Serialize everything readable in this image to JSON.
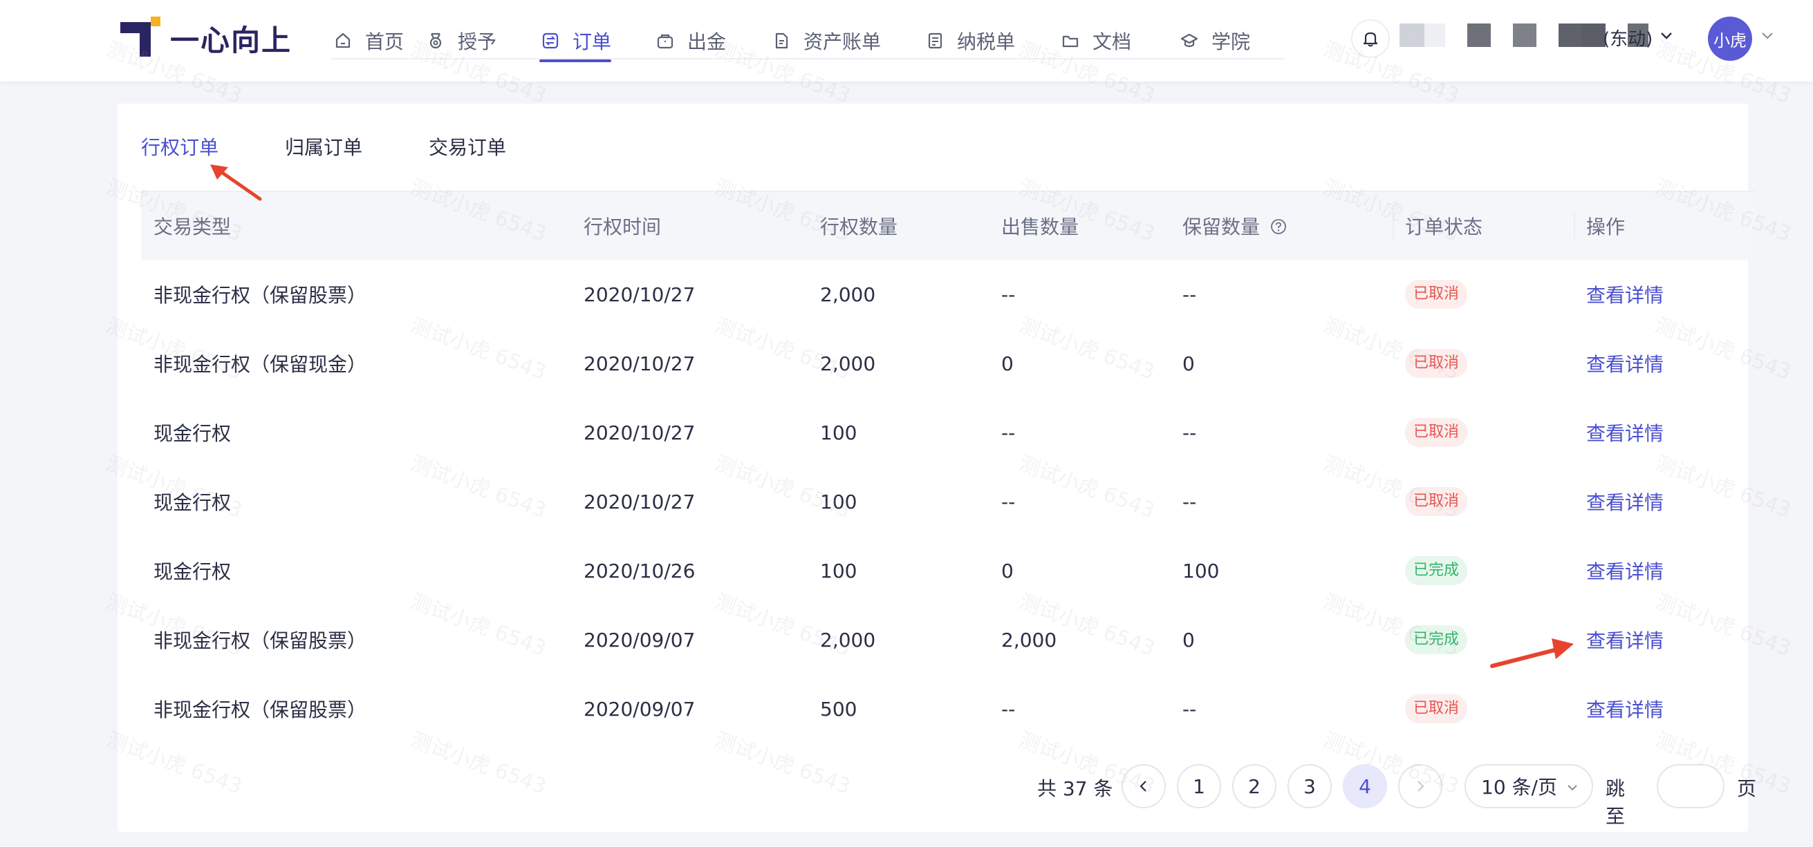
{
  "header": {
    "logo_text": "一心向上",
    "nav": [
      {
        "label": "首页",
        "icon": "home-icon"
      },
      {
        "label": "授予",
        "icon": "medal-icon"
      },
      {
        "label": "订单",
        "icon": "order-exchange-icon",
        "active": true
      },
      {
        "label": "出金",
        "icon": "wallet-icon"
      },
      {
        "label": "资产账单",
        "icon": "document-icon"
      },
      {
        "label": "纳税单",
        "icon": "list-doc-icon"
      },
      {
        "label": "文档",
        "icon": "folder-icon"
      },
      {
        "label": "学院",
        "icon": "graduation-cap-icon"
      }
    ],
    "company_suffix": "(东动)",
    "avatar_text": "小虎"
  },
  "tabs": [
    {
      "label": "行权订单",
      "active": true
    },
    {
      "label": "归属订单"
    },
    {
      "label": "交易订单"
    }
  ],
  "table": {
    "headers": [
      "交易类型",
      "行权时间",
      "行权数量",
      "出售数量",
      "保留数量",
      "订单状态",
      "操作"
    ],
    "rows": [
      {
        "type": "非现金行权（保留股票）",
        "date": "2020/10/27",
        "exercise": "2,000",
        "sold": "--",
        "kept": "--",
        "status": "已取消",
        "action": "查看详情"
      },
      {
        "type": "非现金行权（保留现金）",
        "date": "2020/10/27",
        "exercise": "2,000",
        "sold": "0",
        "kept": "0",
        "status": "已取消",
        "action": "查看详情"
      },
      {
        "type": "现金行权",
        "date": "2020/10/27",
        "exercise": "100",
        "sold": "--",
        "kept": "--",
        "status": "已取消",
        "action": "查看详情"
      },
      {
        "type": "现金行权",
        "date": "2020/10/27",
        "exercise": "100",
        "sold": "--",
        "kept": "--",
        "status": "已取消",
        "action": "查看详情"
      },
      {
        "type": "现金行权",
        "date": "2020/10/26",
        "exercise": "100",
        "sold": "0",
        "kept": "100",
        "status": "已完成",
        "action": "查看详情"
      },
      {
        "type": "非现金行权（保留股票）",
        "date": "2020/09/07",
        "exercise": "2,000",
        "sold": "2,000",
        "kept": "0",
        "status": "已完成",
        "action": "查看详情"
      },
      {
        "type": "非现金行权（保留股票）",
        "date": "2020/09/07",
        "exercise": "500",
        "sold": "--",
        "kept": "--",
        "status": "已取消",
        "action": "查看详情"
      }
    ]
  },
  "pagination": {
    "total": "共 37 条",
    "pages": [
      "1",
      "2",
      "3",
      "4"
    ],
    "current": "4",
    "page_size": "10 条/页",
    "jump_label": "跳至",
    "page_label": "页"
  },
  "watermark": "测试小虎 6543",
  "colors": {
    "accent": "#4a4fd0",
    "cancel": "#e8554e",
    "done": "#2fb56a",
    "annotation": "#e8432e"
  }
}
